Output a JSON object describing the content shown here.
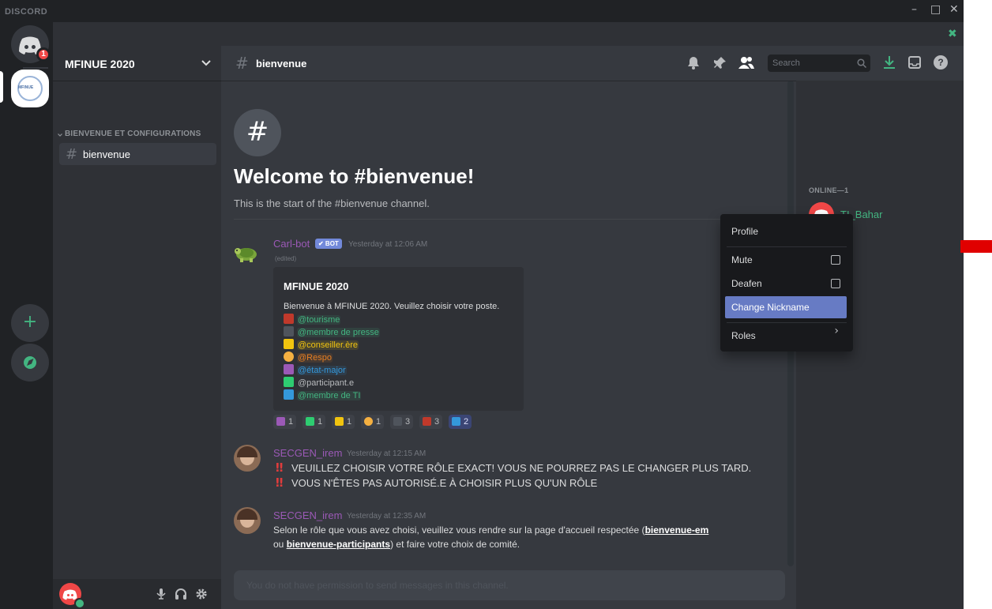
{
  "window": {
    "brand": "DISCORD",
    "controls": {
      "minimize": "–",
      "maximize": "□",
      "close": "✕"
    }
  },
  "rail": {
    "home_badge": "1",
    "server_abbr": "MFINUE"
  },
  "sidebar": {
    "guild_name": "MFINUE 2020",
    "category": "BIENVENUE ET CONFIGURATIONS",
    "channel": "bienvenue"
  },
  "header": {
    "channel": "bienvenue",
    "search_placeholder": "Search"
  },
  "welcome": {
    "title": "Welcome to #bienvenue!",
    "subtitle": "This is the start of the #bienvenue channel."
  },
  "messages": [
    {
      "author": "Carl-bot",
      "bot_tag": "✔ BOT",
      "timestamp": "Yesterday at 12:06 AM",
      "edited": "(edited)",
      "embed": {
        "title": "MFINUE 2020",
        "description": "Bienvenue à MFINUE 2020. Veuillez choisir votre poste.",
        "roles": [
          "@tourisme",
          "@membre de presse",
          "@conseiller.ère",
          "@Respo",
          "@état-major",
          "@participant.e",
          "@membre de TI"
        ]
      },
      "reactions": [
        "1",
        "1",
        "1",
        "1",
        "3",
        "3",
        "2"
      ]
    },
    {
      "author": "SECGEN_irem",
      "timestamp": "Yesterday at 12:15 AM",
      "lines": [
        "VEUILLEZ CHOISIR VOTRE RÔLE EXACT! VOUS NE POURREZ PAS LE CHANGER PLUS TARD.",
        "VOUS N'ÊTES PAS AUTORISÉ.E À CHOISIR PLUS QU'UN RÔLE"
      ]
    },
    {
      "author": "SECGEN_irem",
      "timestamp": "Yesterday at 12:35 AM",
      "line1_pre": "Selon le rôle que vous avez choisi, veuillez vous rendre sur la page d'accueil respectée (",
      "link1": "bienvenue-em",
      "line2_pre": "ou ",
      "link2": "bienvenue-participants",
      "line2_post": ") et faire votre choix de comité."
    }
  ],
  "composer": {
    "placeholder": "You do not have permission to send messages in this channel."
  },
  "members": {
    "online_header": "ONLINE—1",
    "member_name": "TI_Bahar"
  },
  "context_menu": {
    "items": [
      "Profile",
      "Mute",
      "Deafen",
      "Change Nickname",
      "Roles"
    ],
    "roles_arrow": "›"
  },
  "colors": {
    "blurple": "#7289da",
    "bot_name": "#9b59b6",
    "member_green": "#43b581"
  }
}
